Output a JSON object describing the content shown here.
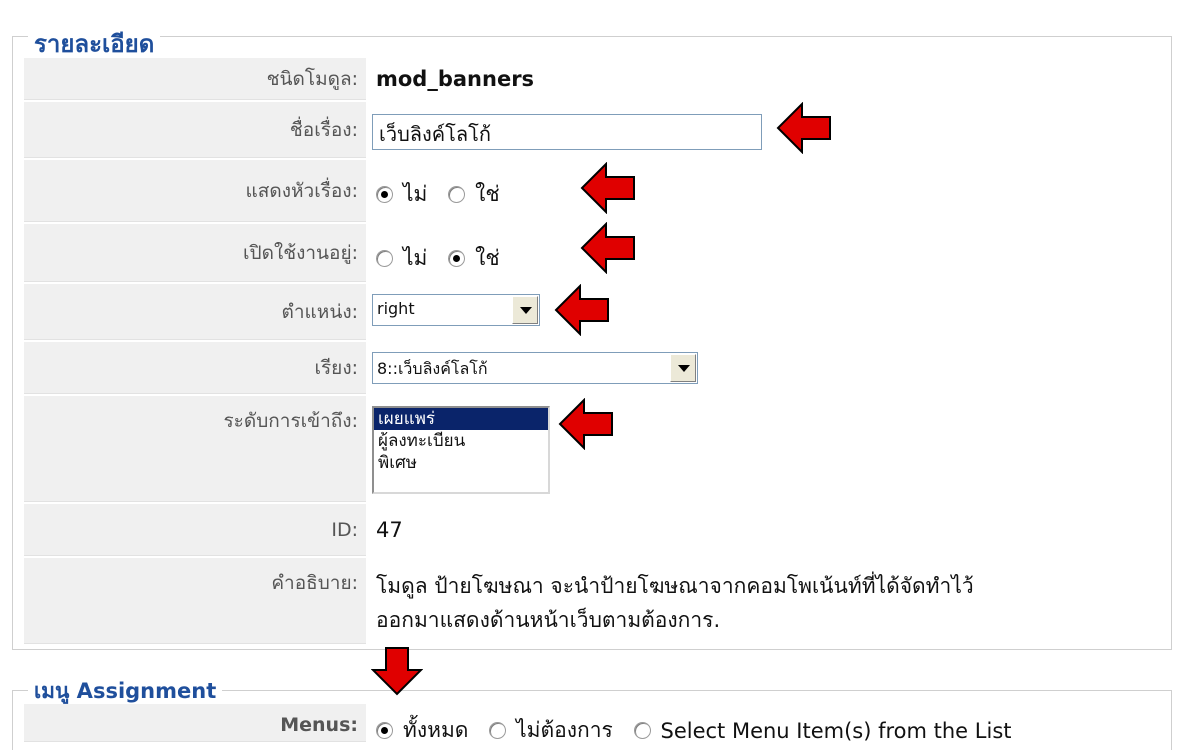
{
  "details": {
    "legend": "รายละเอียด",
    "rows": {
      "module_type": {
        "label": "ชนิดโมดูล:",
        "value": "mod_banners"
      },
      "title": {
        "label": "ชื่อเรื่อง:",
        "value": "เว็บลิงค์โลโก้"
      },
      "show_title": {
        "label": "แสดงหัวเรื่อง:",
        "options": [
          "ไม่",
          "ใช่"
        ],
        "selected": "ไม่"
      },
      "enabled": {
        "label": "เปิดใช้งานอยู่:",
        "options": [
          "ไม่",
          "ใช่"
        ],
        "selected": "ใช่"
      },
      "position": {
        "label": "ตำแหน่ง:",
        "value": "right"
      },
      "order": {
        "label": "เรียง:",
        "value": "8::เว็บลิงค์โลโก้"
      },
      "access": {
        "label": "ระดับการเข้าถึง:",
        "options": [
          "เผยแพร่",
          "ผู้ลงทะเบียน",
          "พิเศษ"
        ],
        "selected": "เผยแพร่"
      },
      "id": {
        "label": "ID:",
        "value": "47"
      },
      "description": {
        "label": "คำอธิบาย:",
        "line1": "โมดูล ป้ายโฆษณา จะนำป้ายโฆษณาจากคอมโพเน้นท์ที่ได้จัดทำไว้",
        "line2": "ออกมาแสดงด้านหน้าเว็บตามต้องการ."
      }
    }
  },
  "menu_assignment": {
    "legend": "เมนู Assignment",
    "menus": {
      "label": "Menus:",
      "options": [
        "ทั้งหมด",
        "ไม่ต้องการ",
        "Select Menu Item(s) from the List"
      ],
      "selected": "ทั้งหมด"
    }
  },
  "colors": {
    "legend": "#1f4f9c",
    "arrow": "#e00000",
    "selected_option": "#0a246a"
  }
}
